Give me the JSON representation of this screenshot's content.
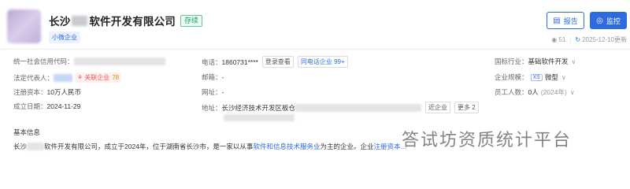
{
  "company": {
    "name_prefix": "长沙",
    "name_suffix": "软件开发有限公司",
    "status": "存续",
    "size_tag": "小微企业"
  },
  "actions": {
    "report_label": "报告",
    "monitor_label": "监控"
  },
  "meta": {
    "views": "51",
    "updated": "2025-12-10更新"
  },
  "info": {
    "credit_code_label": "统一社会信用代码：",
    "legal_rep_label": "法定代表人：",
    "related_label": "关联企业",
    "related_count": "78",
    "capital_label": "注册资本：",
    "capital_value": "10万人民币",
    "founded_label": "成立日期：",
    "founded_value": "2024-11-29",
    "phone_label": "电话：",
    "phone_value": "1860731****",
    "phone_view_btn": "登录查看",
    "same_phone_btn": "同电话企业 99+",
    "email_label": "邮箱：",
    "email_value": "-",
    "website_label": "网址：",
    "website_value": "-",
    "address_label": "地址：",
    "address_value": "长沙经济技术开发区板仓",
    "nearby_btn": "近企业",
    "more_btn": "更多 2",
    "industry_label": "国标行业：",
    "industry_value": "基础软件开发",
    "scale_label": "企业规模：",
    "scale_tag": "XS",
    "scale_value": "微型",
    "staff_label": "员工人数：",
    "staff_value": "0人",
    "staff_year": "(2024年)"
  },
  "basic": {
    "title": "基本信息",
    "prefix": "长沙",
    "text_a": "软件开发有限公司，成立于2024年，位于湖南省长沙市，是一家以从事",
    "link": "软件和信息技术服务业",
    "text_b": "为主的企业。企业",
    "text_c": "注册资本…"
  },
  "watermark": "答试坊资质统计平台"
}
